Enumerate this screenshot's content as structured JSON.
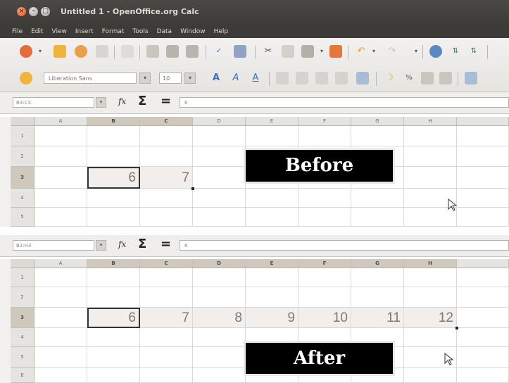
{
  "window": {
    "title": "Untitled 1 - OpenOffice.org Calc",
    "buttons": [
      "×",
      "–",
      "□"
    ]
  },
  "menu": [
    "File",
    "Edit",
    "View",
    "Insert",
    "Format",
    "Tools",
    "Data",
    "Window",
    "Help"
  ],
  "toolbar": {
    "font_name": "Liberation Sans",
    "font_size": "10"
  },
  "before": {
    "namebox": "B3:C3",
    "formula_symbols": {
      "fx": "fx",
      "sum": "Σ",
      "equals": "="
    },
    "formula_value": "6",
    "columns": [
      "A",
      "B",
      "C",
      "D",
      "E",
      "F",
      "G",
      "H"
    ],
    "rows": [
      "1",
      "2",
      "3",
      "4",
      "5"
    ],
    "row3_values": [
      "6",
      "7"
    ],
    "label": "Before"
  },
  "after": {
    "namebox": "B3:H3",
    "formula_symbols": {
      "fx": "fx",
      "sum": "Σ",
      "equals": "="
    },
    "formula_value": "6",
    "columns": [
      "A",
      "B",
      "C",
      "D",
      "E",
      "F",
      "G",
      "H"
    ],
    "rows": [
      "1",
      "2",
      "3",
      "4",
      "5",
      "6"
    ],
    "row3_values": [
      "6",
      "7",
      "8",
      "9",
      "10",
      "11",
      "12"
    ],
    "label": "After"
  },
  "colors": {
    "title_bar": "#3c3b37",
    "selection_header": "#cfc8bd",
    "label_background": "#000000",
    "label_text": "#ffffff"
  }
}
